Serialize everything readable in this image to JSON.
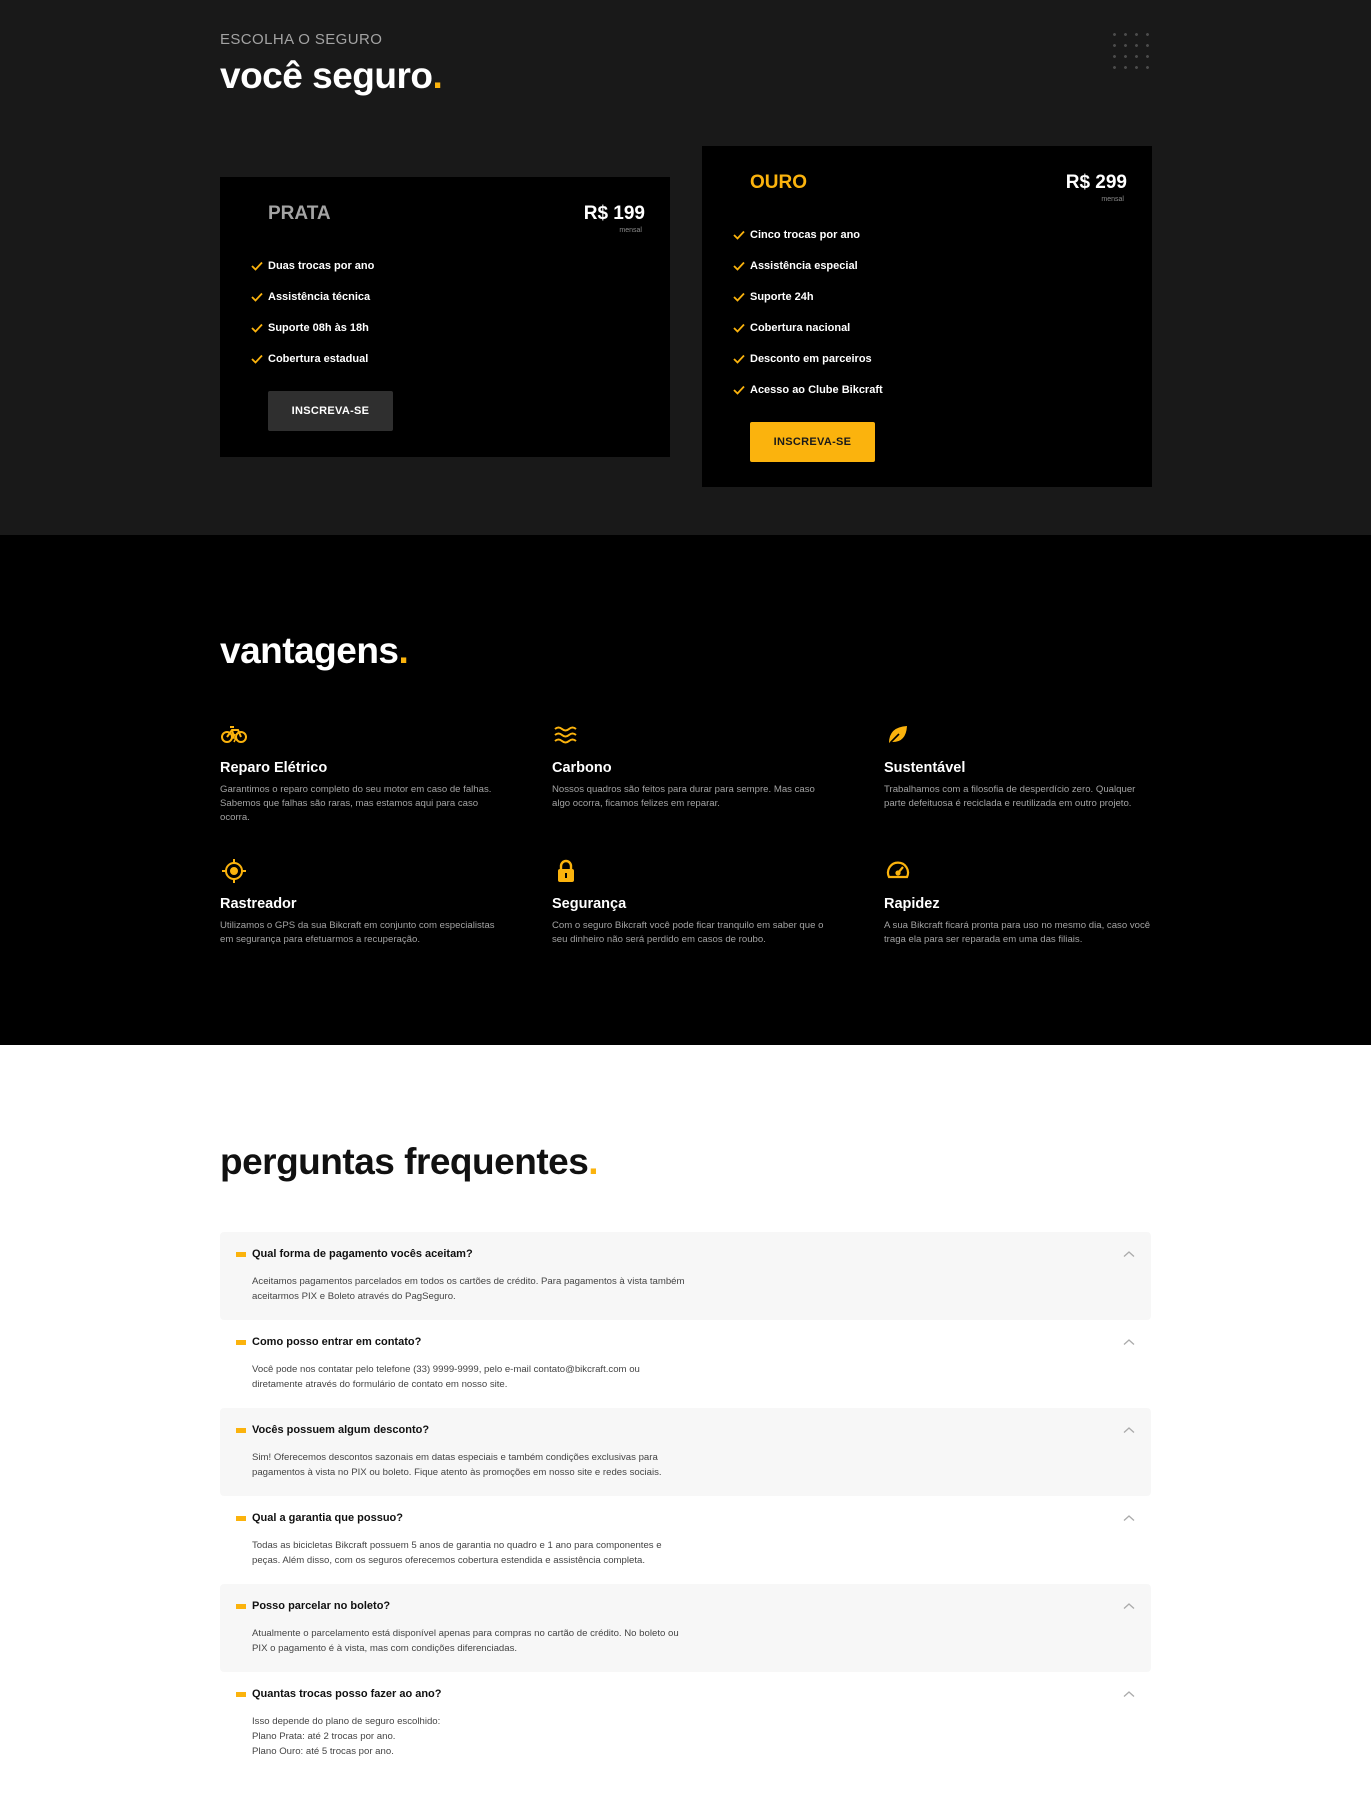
{
  "seguro": {
    "eyebrow": "ESCOLHA O SEGURO",
    "title": "você seguro",
    "title_dot": ".",
    "plans": [
      {
        "name": "PRATA",
        "price": "R$ 199",
        "period": "mensal",
        "features": [
          "Duas trocas por ano",
          "Assistência técnica",
          "Suporte 08h às 18h",
          "Cobertura estadual"
        ],
        "button": "INSCREVA-SE"
      },
      {
        "name": "OURO",
        "price": "R$ 299",
        "period": "mensal",
        "features": [
          "Cinco trocas por ano",
          "Assistência especial",
          "Suporte 24h",
          "Cobertura nacional",
          "Desconto em parceiros",
          "Acesso ao Clube Bikcraft"
        ],
        "button": "INSCREVA-SE"
      }
    ]
  },
  "vantagens": {
    "title": "vantagens",
    "title_dot": ".",
    "items": [
      {
        "icon": "electric-bike-icon",
        "name": "Reparo Elétrico",
        "desc": "Garantimos o reparo completo do seu motor em caso de falhas. Sabemos que falhas são raras, mas estamos aqui para caso ocorra."
      },
      {
        "icon": "waves-icon",
        "name": "Carbono",
        "desc": "Nossos quadros são feitos para durar para sempre. Mas caso algo ocorra, ficamos felizes em reparar."
      },
      {
        "icon": "leaf-icon",
        "name": "Sustentável",
        "desc": "Trabalhamos com a filosofia de desperdício zero. Qualquer parte defeituosa é reciclada e reutilizada em outro projeto."
      },
      {
        "icon": "location-target-icon",
        "name": "Rastreador",
        "desc": "Utilizamos o GPS da sua Bikcraft em conjunto com especialistas em segurança para efetuarmos a recuperação."
      },
      {
        "icon": "lock-icon",
        "name": "Segurança",
        "desc": "Com o seguro Bikcraft você pode ficar tranquilo em saber que o seu dinheiro não será perdido em casos de roubo."
      },
      {
        "icon": "speedometer-icon",
        "name": "Rapidez",
        "desc": "A sua Bikcraft ficará pronta para uso no mesmo dia, caso você traga ela para ser reparada em uma das filiais."
      }
    ]
  },
  "faq": {
    "title": "perguntas frequentes",
    "title_dot": ".",
    "items": [
      {
        "q": "Qual forma de pagamento vocês aceitam?",
        "a": "Aceitamos pagamentos parcelados em todos os cartões de crédito. Para pagamentos à vista também aceitarmos PIX e Boleto através do PagSeguro."
      },
      {
        "q": "Como posso entrar em contato?",
        "a": "Você pode nos contatar pelo telefone (33) 9999-9999, pelo e-mail contato@bikcraft.com ou diretamente através do formulário de contato em nosso site."
      },
      {
        "q": "Vocês possuem algum desconto?",
        "a": "Sim! Oferecemos descontos sazonais em datas especiais e também condições exclusivas para pagamentos à vista no PIX ou boleto. Fique atento às promoções em nosso site e redes sociais."
      },
      {
        "q": "Qual a garantia que possuo?",
        "a": "Todas as bicicletas Bikcraft possuem 5 anos de garantia no quadro e 1 ano para componentes e peças. Além disso, com os seguros oferecemos cobertura estendida e assistência completa."
      },
      {
        "q": "Posso parcelar no boleto?",
        "a": "Atualmente o parcelamento está disponível apenas para compras no cartão de crédito. No boleto ou PIX o pagamento é à vista, mas com condições diferenciadas."
      },
      {
        "q": "Quantas trocas posso fazer ao ano?",
        "a": "Isso depende do plano de seguro escolhido:\nPlano Prata: até 2 trocas por ano.\nPlano Ouro: até 5 trocas por ano."
      }
    ]
  },
  "colors": {
    "accent": "#fbb30d",
    "dark": "#191919",
    "black": "#000000",
    "muted": "#a3a3a3"
  }
}
